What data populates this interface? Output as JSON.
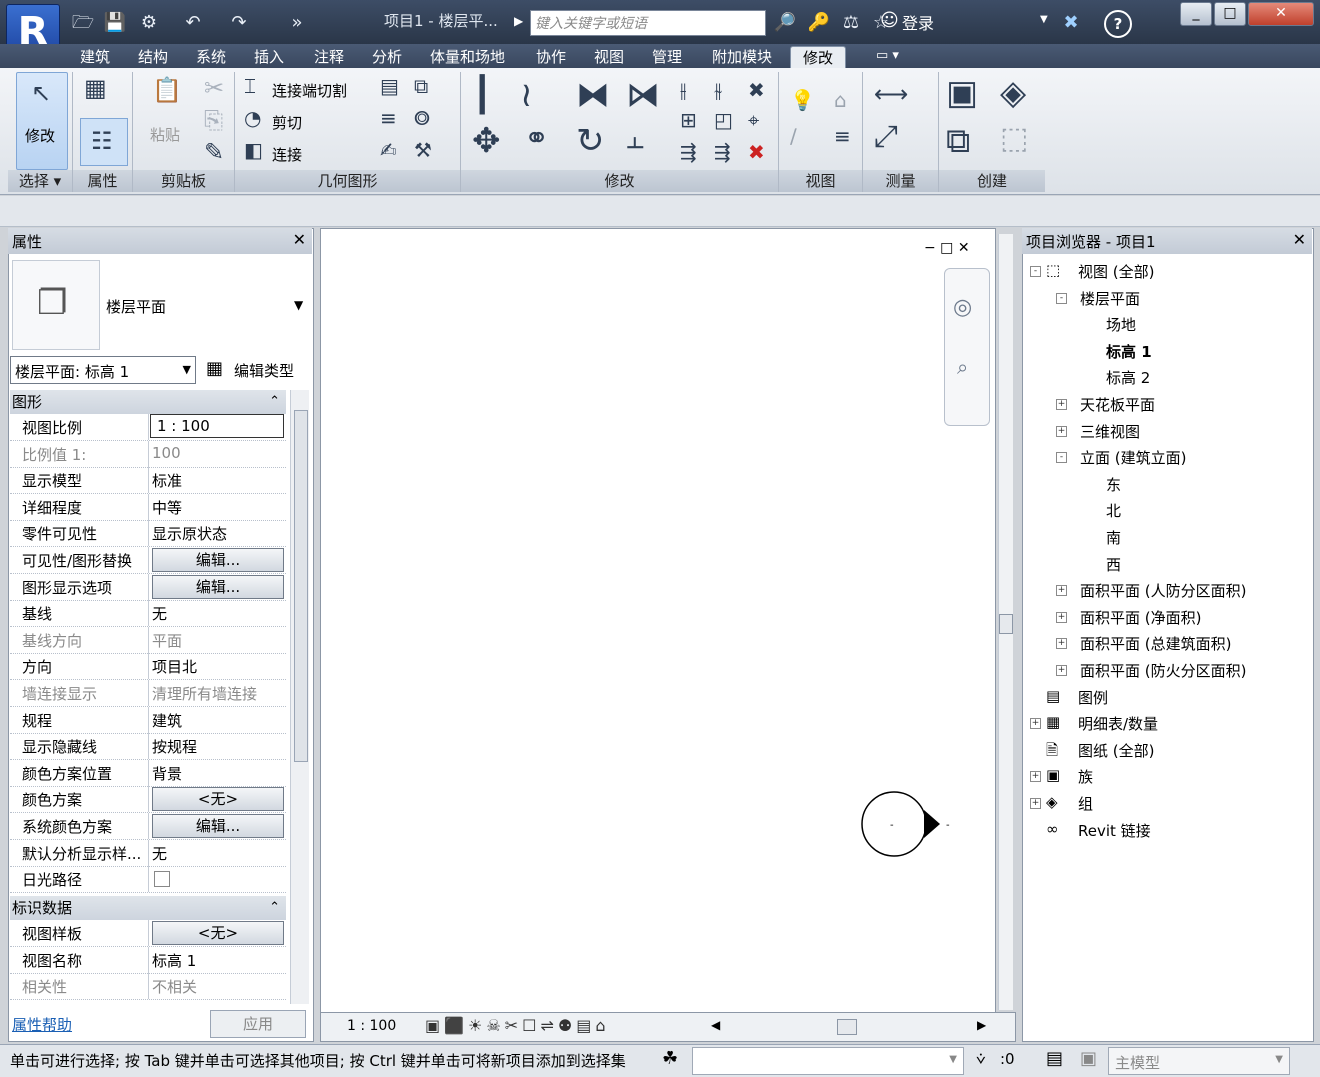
{
  "app": {
    "title": "项目1 - 楼层平...",
    "search_placeholder": "键入关键字或短语",
    "login": "登录",
    "help": "?"
  },
  "tabs": [
    "建筑",
    "结构",
    "系统",
    "插入",
    "注释",
    "分析",
    "体量和场地",
    "协作",
    "视图",
    "管理",
    "附加模块",
    "修改"
  ],
  "active_tab": "修改",
  "ribbon": {
    "modify_label": "修改",
    "paste_label": "粘贴",
    "join_cut": "连接端切割",
    "cut": "剪切",
    "join": "连接",
    "panels": {
      "select": "选择",
      "properties": "属性",
      "clipboard": "剪贴板",
      "geometry": "几何图形",
      "modify": "修改",
      "view": "视图",
      "measure": "测量",
      "create": "创建"
    }
  },
  "properties": {
    "title": "属性",
    "type_name": "楼层平面",
    "instance_selector": "楼层平面: 标高 1",
    "edit_type": "编辑类型",
    "section_graphics": "图形",
    "section_identity": "标识数据",
    "rows_graphics": [
      {
        "k": "视图比例",
        "v": "1 : 100",
        "kind": "input"
      },
      {
        "k": "比例值 1:",
        "v": "100",
        "kind": "dim"
      },
      {
        "k": "显示模型",
        "v": "标准",
        "kind": "text"
      },
      {
        "k": "详细程度",
        "v": "中等",
        "kind": "text"
      },
      {
        "k": "零件可见性",
        "v": "显示原状态",
        "kind": "text"
      },
      {
        "k": "可见性/图形替换",
        "v": "编辑...",
        "kind": "button"
      },
      {
        "k": "图形显示选项",
        "v": "编辑...",
        "kind": "button"
      },
      {
        "k": "基线",
        "v": "无",
        "kind": "text"
      },
      {
        "k": "基线方向",
        "v": "平面",
        "kind": "dim"
      },
      {
        "k": "方向",
        "v": "项目北",
        "kind": "text"
      },
      {
        "k": "墙连接显示",
        "v": "清理所有墙连接",
        "kind": "dim"
      },
      {
        "k": "规程",
        "v": "建筑",
        "kind": "text"
      },
      {
        "k": "显示隐藏线",
        "v": "按规程",
        "kind": "text"
      },
      {
        "k": "颜色方案位置",
        "v": "背景",
        "kind": "text"
      },
      {
        "k": "颜色方案",
        "v": "<无>",
        "kind": "button"
      },
      {
        "k": "系统颜色方案",
        "v": "编辑...",
        "kind": "button"
      },
      {
        "k": "默认分析显示样...",
        "v": "无",
        "kind": "text"
      },
      {
        "k": "日光路径",
        "v": "",
        "kind": "checkbox"
      }
    ],
    "rows_identity": [
      {
        "k": "视图样板",
        "v": "<无>",
        "kind": "button"
      },
      {
        "k": "视图名称",
        "v": "标高 1",
        "kind": "text"
      },
      {
        "k": "相关性",
        "v": "不相关",
        "kind": "dim"
      }
    ],
    "help_link": "属性帮助",
    "apply": "应用"
  },
  "canvas": {
    "scale": "1 : 100"
  },
  "browser": {
    "title": "项目浏览器 - 项目1",
    "items": [
      {
        "label": "视图 (全部)",
        "depth": 0,
        "exp": "-"
      },
      {
        "label": "楼层平面",
        "depth": 1,
        "exp": "-"
      },
      {
        "label": "场地",
        "depth": 2,
        "exp": ""
      },
      {
        "label": "标高 1",
        "depth": 2,
        "exp": "",
        "bold": true
      },
      {
        "label": "标高 2",
        "depth": 2,
        "exp": ""
      },
      {
        "label": "天花板平面",
        "depth": 1,
        "exp": "+"
      },
      {
        "label": "三维视图",
        "depth": 1,
        "exp": "+"
      },
      {
        "label": "立面 (建筑立面)",
        "depth": 1,
        "exp": "-"
      },
      {
        "label": "东",
        "depth": 2,
        "exp": ""
      },
      {
        "label": "北",
        "depth": 2,
        "exp": ""
      },
      {
        "label": "南",
        "depth": 2,
        "exp": ""
      },
      {
        "label": "西",
        "depth": 2,
        "exp": ""
      },
      {
        "label": "面积平面 (人防分区面积)",
        "depth": 1,
        "exp": "+"
      },
      {
        "label": "面积平面 (净面积)",
        "depth": 1,
        "exp": "+"
      },
      {
        "label": "面积平面 (总建筑面积)",
        "depth": 1,
        "exp": "+"
      },
      {
        "label": "面积平面 (防火分区面积)",
        "depth": 1,
        "exp": "+"
      },
      {
        "label": "图例",
        "depth": 0,
        "exp": ""
      },
      {
        "label": "明细表/数量",
        "depth": 0,
        "exp": "+"
      },
      {
        "label": "图纸 (全部)",
        "depth": 0,
        "exp": ""
      },
      {
        "label": "族",
        "depth": 0,
        "exp": "+"
      },
      {
        "label": "组",
        "depth": 0,
        "exp": "+"
      },
      {
        "label": "Revit 链接",
        "depth": 0,
        "exp": ""
      }
    ]
  },
  "status": {
    "message": "单击可进行选择; 按 Tab 键并单击可选择其他项目; 按 Ctrl 键并单击可将新项目添加到选择集",
    "count": ":0",
    "model": "主模型"
  }
}
